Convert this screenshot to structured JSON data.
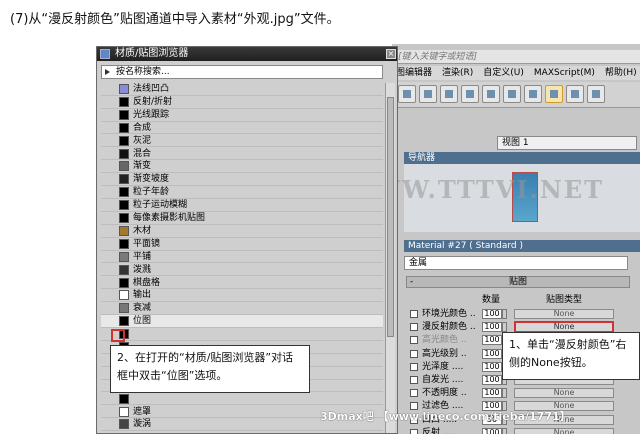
{
  "caption": "(7)从“漫反射颜色”贴图通道中导入素材“外观.jpg”文件。",
  "max": {
    "search_placeholder": "[键入关键字或短语]",
    "menu": [
      "图编辑器",
      "渲染(R)",
      "自定义(U)",
      "MAXScript(M)",
      "帮助(H)"
    ],
    "viewport_label": "视图 1",
    "navigator_label": "导航器",
    "material_title": "Material #27  ( Standard )",
    "material_name": "金属",
    "rollout_title": "贴图",
    "col_amount": "数量",
    "col_maptype": "贴图类型",
    "map_rows": [
      {
        "label": "环境光颜色 ..",
        "amount": "100",
        "map": "None",
        "dim": false,
        "highlight": false
      },
      {
        "label": "漫反射颜色 ..",
        "amount": "100",
        "map": "None",
        "dim": false,
        "highlight": true
      },
      {
        "label": "高光颜色 ..",
        "amount": "100",
        "map": "",
        "dim": true,
        "highlight": false
      },
      {
        "label": "高光级别 ..",
        "amount": "100",
        "map": "",
        "dim": false,
        "highlight": false
      },
      {
        "label": "光泽度 ....",
        "amount": "100",
        "map": "",
        "dim": false,
        "highlight": false
      },
      {
        "label": "自发光 ....",
        "amount": "100",
        "map": "",
        "dim": false,
        "highlight": false
      },
      {
        "label": "不透明度 ..",
        "amount": "100",
        "map": "None",
        "dim": false,
        "highlight": false
      },
      {
        "label": "过滤色 ....",
        "amount": "100",
        "map": "None",
        "dim": false,
        "highlight": false
      },
      {
        "label": "凹凸 .....",
        "amount": "30",
        "map": "None",
        "dim": false,
        "highlight": false
      },
      {
        "label": "反射 .....",
        "amount": "100",
        "map": "None",
        "dim": false,
        "highlight": false
      }
    ],
    "watermark": "騰龍視覺 WWW.TTTVI.NET"
  },
  "dialog": {
    "title": "材质/贴图浏览器",
    "search_label": "按名称搜索...",
    "maps": [
      {
        "name": "法线凹凸",
        "color": "#8a8ad8"
      },
      {
        "name": "反射/折射",
        "color": "#000000"
      },
      {
        "name": "光线跟踪",
        "color": "#000000"
      },
      {
        "name": "合成",
        "color": "#000000"
      },
      {
        "name": "灰泥",
        "color": "#000000"
      },
      {
        "name": "混合",
        "color": "#111111"
      },
      {
        "name": "渐变",
        "color": "#666666"
      },
      {
        "name": "渐变坡度",
        "color": "#222222"
      },
      {
        "name": "粒子年龄",
        "color": "#000000"
      },
      {
        "name": "粒子运动模糊",
        "color": "#000000"
      },
      {
        "name": "每像素摄影机贴图",
        "color": "#000000"
      },
      {
        "name": "木材",
        "color": "#a07830"
      },
      {
        "name": "平面镜",
        "color": "#000000"
      },
      {
        "name": "平铺",
        "color": "#7a7a7a"
      },
      {
        "name": "泼溅",
        "color": "#333333"
      },
      {
        "name": "棋盘格",
        "color": "#000000"
      },
      {
        "name": "输出",
        "color": "#ffffff"
      },
      {
        "name": "衰减",
        "color": "#777777"
      },
      {
        "name": "位图",
        "color": "#000000"
      },
      {
        "name": "",
        "color": "#000000"
      },
      {
        "name": "",
        "color": "#000000"
      },
      {
        "name": "",
        "color": "#000000"
      },
      {
        "name": "",
        "color": "#000000"
      },
      {
        "name": "",
        "color": "#000000"
      },
      {
        "name": "",
        "color": "#000000"
      },
      {
        "name": "遮罩",
        "color": "#ffffff"
      },
      {
        "name": "漩涡",
        "color": "#444444"
      }
    ]
  },
  "callouts": {
    "left": "2、在打开的“材质/贴图浏览器”对话框中双击“位图”选项。",
    "right": "1、单击“漫反射颜色”右侧的None按钮。"
  },
  "bottom_watermark": "3Dmax吧 【www.lineco.com/tieba/1771】"
}
